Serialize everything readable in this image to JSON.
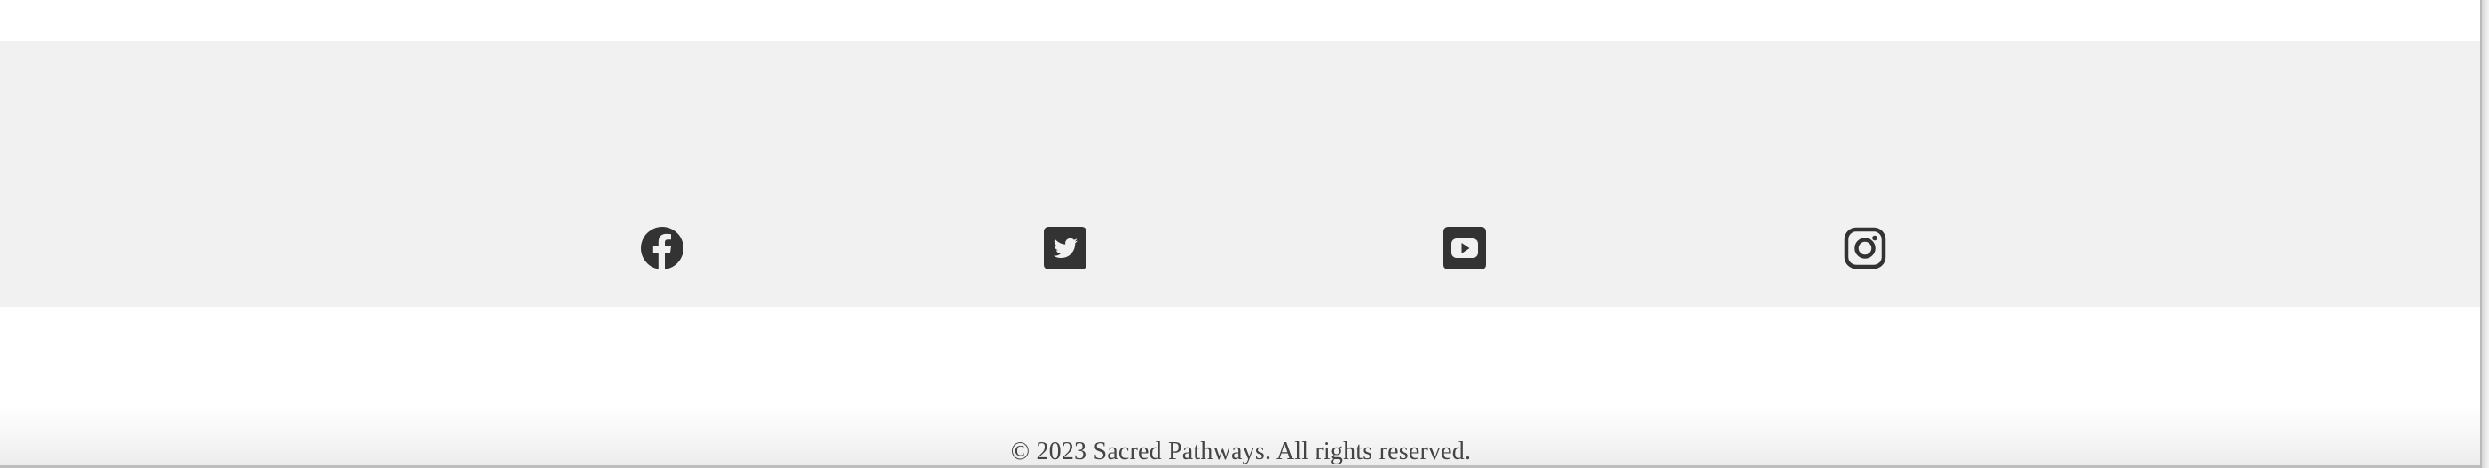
{
  "social": {
    "links": [
      {
        "name": "facebook-icon",
        "label": "Facebook"
      },
      {
        "name": "twitter-icon",
        "label": "Twitter"
      },
      {
        "name": "youtube-icon",
        "label": "YouTube"
      },
      {
        "name": "instagram-icon",
        "label": "Instagram"
      }
    ],
    "icon_color": "#333333",
    "band_color": "#f1f1f1"
  },
  "footer": {
    "copyright": "© 2023 Sacred Pathways. All rights reserved."
  }
}
